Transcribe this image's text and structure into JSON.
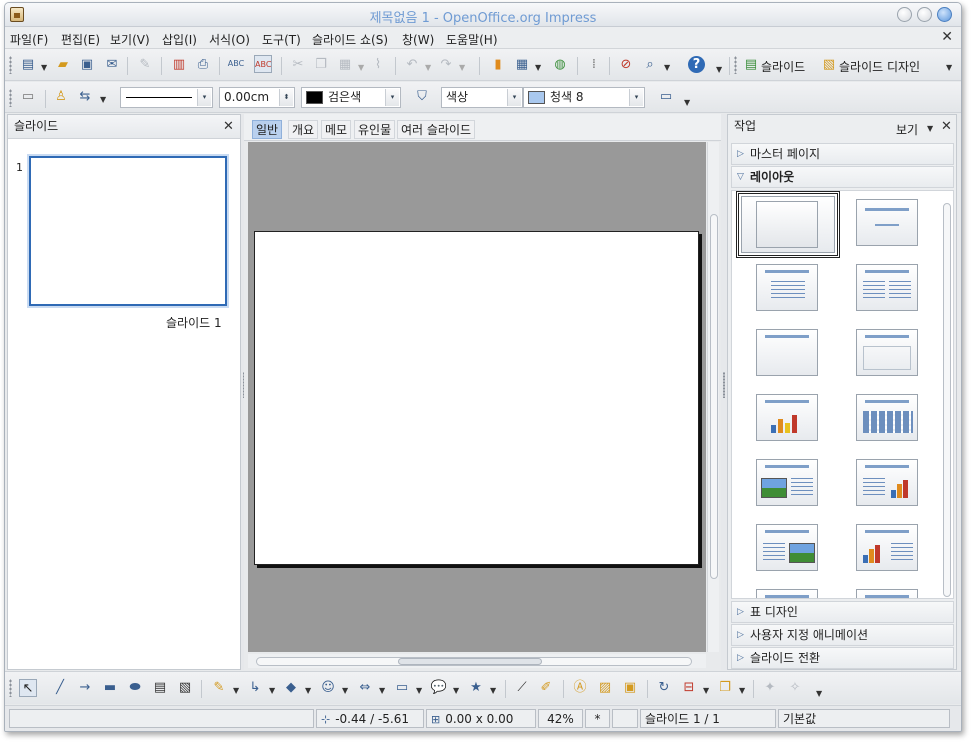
{
  "window": {
    "title": "제목없음 1 - OpenOffice.org Impress",
    "icon": "impress-app-icon"
  },
  "menu": {
    "items": [
      "파일(F)",
      "편집(E)",
      "보기(V)",
      "삽입(I)",
      "서식(O)",
      "도구(T)",
      "슬라이드 쇼(S)",
      "창(W)",
      "도움말(H)"
    ],
    "close_glyph": "✕"
  },
  "standard_toolbar": {
    "slide_label": "슬라이드",
    "slide_design_label": "슬라이드 디자인",
    "icons": [
      "new-icon",
      "open-icon",
      "save-icon",
      "email-icon",
      "edit-file-icon",
      "export-pdf-icon",
      "print-icon",
      "spellcheck-icon",
      "autospellcheck-icon",
      "cut-icon",
      "copy-icon",
      "paste-icon",
      "clone-format-icon",
      "undo-icon",
      "redo-icon",
      "chart-icon",
      "table-icon",
      "show-draw-functions-icon",
      "grid-icon",
      "navigator-icon",
      "zoom-icon",
      "help-icon"
    ]
  },
  "line_toolbar": {
    "line_width": "0.00cm",
    "line_color": {
      "label": "검은색",
      "color": "#000000"
    },
    "area_style": "색상",
    "area_color": {
      "label": "청색 8",
      "color": "#a9c8ee"
    }
  },
  "slides_pane": {
    "title": "슬라이드",
    "close_glyph": "✕",
    "slides": [
      {
        "number": "1",
        "caption": "슬라이드 1"
      }
    ]
  },
  "view_tabs": [
    "일반",
    "개요",
    "메모",
    "유인물",
    "여러 슬라이드"
  ],
  "active_view_tab": "일반",
  "task_pane": {
    "title": "작업",
    "view_label": "보기",
    "close_glyph": "✕",
    "sections": [
      {
        "label": "마스터 페이지",
        "expanded": false
      },
      {
        "label": "레이아웃",
        "expanded": true
      },
      {
        "label": "표 디자인",
        "expanded": false
      },
      {
        "label": "사용자 지정 애니메이션",
        "expanded": false
      },
      {
        "label": "슬라이드 전환",
        "expanded": false
      }
    ],
    "layouts": [
      "blank",
      "title-only",
      "title-content",
      "title-two-content",
      "title-centered-text",
      "title-box",
      "title-chart",
      "title-table",
      "picture-text",
      "text-chart",
      "text-picture",
      "chart-text"
    ]
  },
  "drawing_toolbar": {
    "icons": [
      "select-icon",
      "line-icon",
      "arrow-line-icon",
      "rectangle-icon",
      "ellipse-icon",
      "text-icon",
      "fontwork-text-icon",
      "curve-icon",
      "connector-icon",
      "basic-shapes-icon",
      "symbol-shapes-icon",
      "block-arrows-icon",
      "flowchart-icon",
      "callouts-icon",
      "stars-icon",
      "points-icon",
      "glue-points-icon",
      "fontwork-gallery-icon",
      "from-file-icon",
      "gallery-icon",
      "rotate-icon",
      "alignment-icon",
      "arrange-icon",
      "extrusion-icon",
      "3d-effects-icon"
    ]
  },
  "status": {
    "position": "-0.44 / -5.61",
    "size": "0.00 x 0.00",
    "zoom": "42%",
    "modified": "*",
    "slide": "슬라이드 1 / 1",
    "layout": "기본값"
  }
}
